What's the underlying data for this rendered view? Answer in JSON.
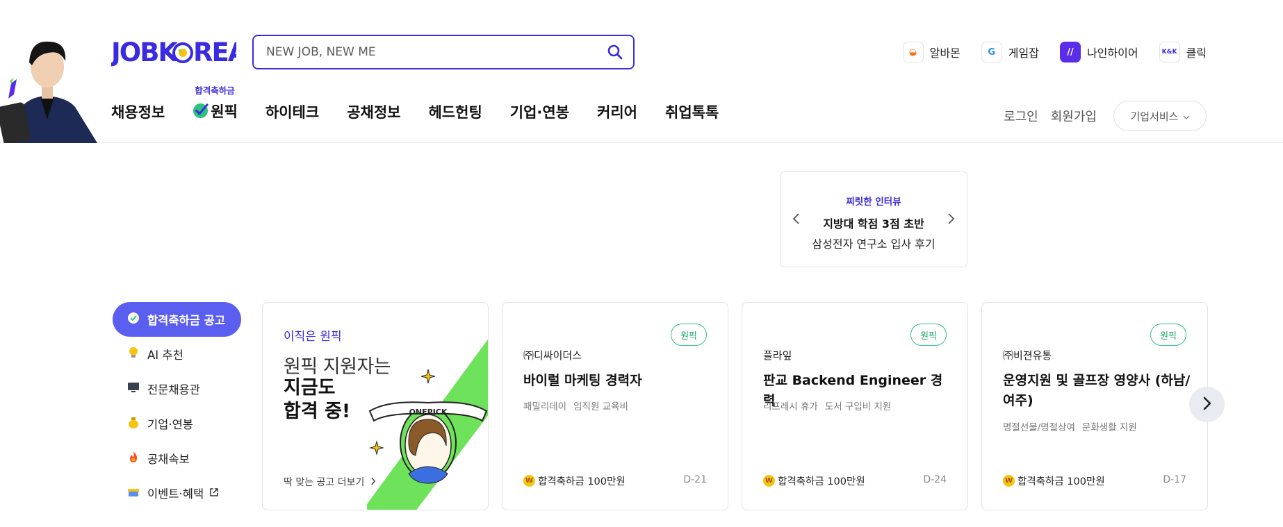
{
  "header": {
    "search": {
      "placeholder": "NEW JOB, NEW ME"
    },
    "partners": [
      {
        "label": "알바몬",
        "icon": "albamon-icon",
        "color": "#ff6a13"
      },
      {
        "label": "게임잡",
        "icon": "gamejob-icon",
        "color": "#2d8cf0"
      },
      {
        "label": "나인하이어",
        "icon": "ninehire-icon",
        "color": "#5a2ee8"
      },
      {
        "label": "클릭",
        "icon": "klik-icon",
        "color": "#3b2be0"
      }
    ],
    "nav": {
      "badge": "합격축하금",
      "items": [
        "채용정보",
        "원픽",
        "하이테크",
        "공채정보",
        "헤드헌팅",
        "기업·연봉",
        "커리어",
        "취업톡톡"
      ]
    },
    "util": {
      "login": "로그인",
      "signup": "회원가입",
      "biz": "기업서비스"
    }
  },
  "interview": {
    "tag": "찌릿한 인터뷰",
    "line1": "지방대 학점 3점 초반",
    "line2": "삼성전자 연구소 입사 후기"
  },
  "side_menu": [
    {
      "label": "합격축하금 공고",
      "icon": "check-circle-icon",
      "active": true
    },
    {
      "label": "AI 추천",
      "icon": "bulb-icon"
    },
    {
      "label": "전문채용관",
      "icon": "monitor-icon"
    },
    {
      "label": "기업·연봉",
      "icon": "money-bag-icon"
    },
    {
      "label": "공채속보",
      "icon": "fire-icon"
    },
    {
      "label": "이벤트·혜택",
      "icon": "gift-icon"
    }
  ],
  "promo": {
    "eyebrow": "이직은 원픽",
    "headline1": "원픽 지원자는",
    "headline2": "지금도",
    "headline3": "합격 중!",
    "more": "딱 맞는 공고 더보기",
    "art_text": "ONEPICK"
  },
  "jobs": [
    {
      "chip": "원픽",
      "company": "㈜디싸이더스",
      "title": "바이럴 마케팅 경력자",
      "perks": [
        "패밀리데이",
        "임직원 교육비"
      ],
      "reward": "합격축하금 100만원",
      "dday": "D-21"
    },
    {
      "chip": "원픽",
      "company": "플라잎",
      "title": "판교 Backend Engineer 경력",
      "perks": [
        "리프레시 휴가",
        "도서 구입비 지원"
      ],
      "reward": "합격축하금 100만원",
      "dday": "D-24"
    },
    {
      "chip": "원픽",
      "company": "㈜비젼유통",
      "title": "운영지원 및 골프장 영양사 (하남/여주)",
      "perks": [
        "명절선물/명절상여",
        "문화생활 지원"
      ],
      "reward": "합격축하금 100만원",
      "dday": "D-17"
    }
  ],
  "coin_symbol": "W",
  "brand_color": "#3b2be0"
}
